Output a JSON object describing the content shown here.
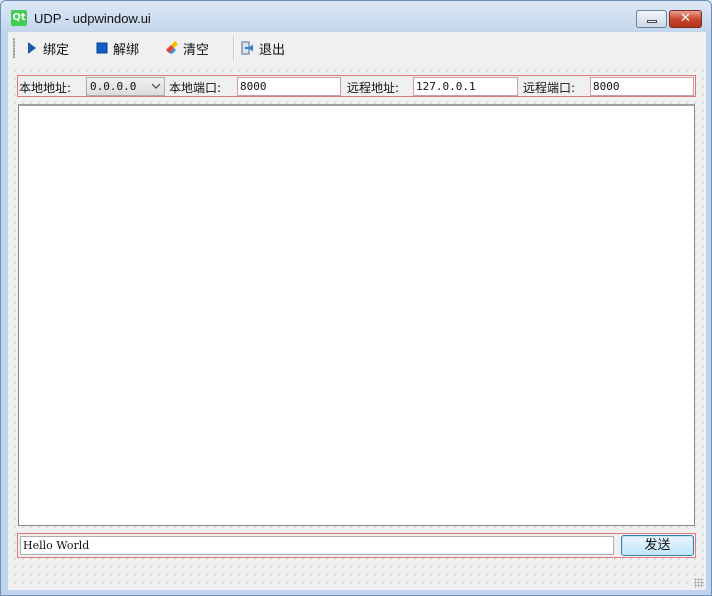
{
  "window": {
    "title": "UDP - udpwindow.ui",
    "app_icon_text": "Qt",
    "close_glyph": "✕"
  },
  "toolbar": {
    "bind_label": "绑定",
    "unbind_label": "解绑",
    "clear_label": "清空",
    "exit_label": "退出"
  },
  "settings": {
    "local_addr_label": "本地地址:",
    "local_addr_value": "0.0.0.0",
    "local_port_label": "本地端口:",
    "local_port_value": "8000",
    "remote_addr_label": "远程地址:",
    "remote_addr_value": "127.0.0.1",
    "remote_port_label": "远程端口:",
    "remote_port_value": "8000"
  },
  "send": {
    "message_value": "Hello World",
    "send_label": "发送"
  },
  "icons": {
    "bind": "play-icon",
    "unbind": "stop-icon",
    "clear": "eraser-icon",
    "exit": "exit-door-icon"
  },
  "colors": {
    "layout_border": "#e07a7a",
    "play_icon": "#1a58b3",
    "stop_icon": "#0b5fc7",
    "send_button_border": "#3c7fb1"
  }
}
